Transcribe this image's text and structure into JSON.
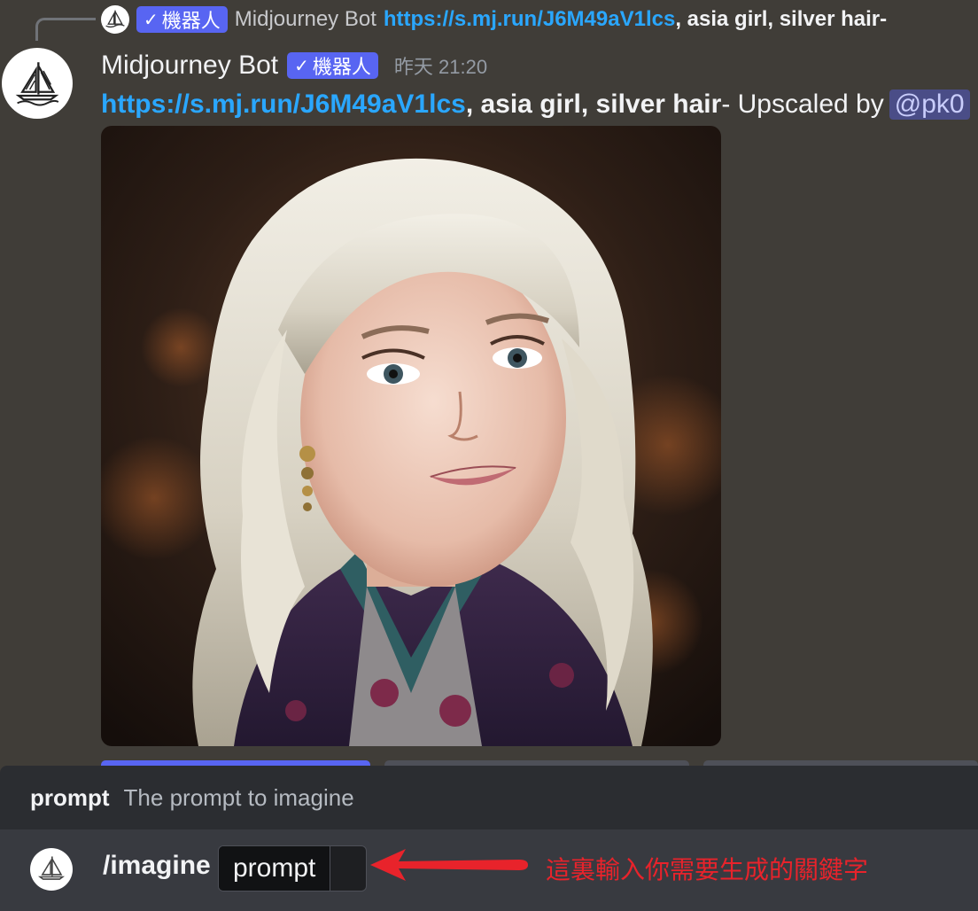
{
  "reply": {
    "badge": "機器人",
    "author": "Midjourney Bot",
    "link": "https://s.mj.run/J6M49aV1lcs",
    "prompt_text": ", asia girl, silver hair",
    "trail": " -"
  },
  "message": {
    "username": "Midjourney Bot",
    "badge": "機器人",
    "timestamp": "昨天 21:20",
    "link": "https://s.mj.run/J6M49aV1lcs",
    "prompt_text": ", asia girl, silver hair",
    "suffix": " - Upscaled by",
    "mention": "@pk0"
  },
  "suggestion": {
    "param_name": "prompt",
    "param_desc": "The prompt to imagine"
  },
  "composer": {
    "command": "/imagine",
    "param_label": "prompt"
  },
  "annotation": {
    "text": "這裏輸入你需要生成的關鍵字",
    "color": "#e8232b"
  },
  "colors": {
    "background": "#403d38",
    "link": "#2aa7ff",
    "badge": "#5865f2",
    "button_primary": "#5865f2",
    "button_secondary": "#4e5058"
  },
  "icons": {
    "avatar": "midjourney-boat-logo",
    "badge": "checkmark-icon",
    "annotation": "red-arrow-icon"
  }
}
